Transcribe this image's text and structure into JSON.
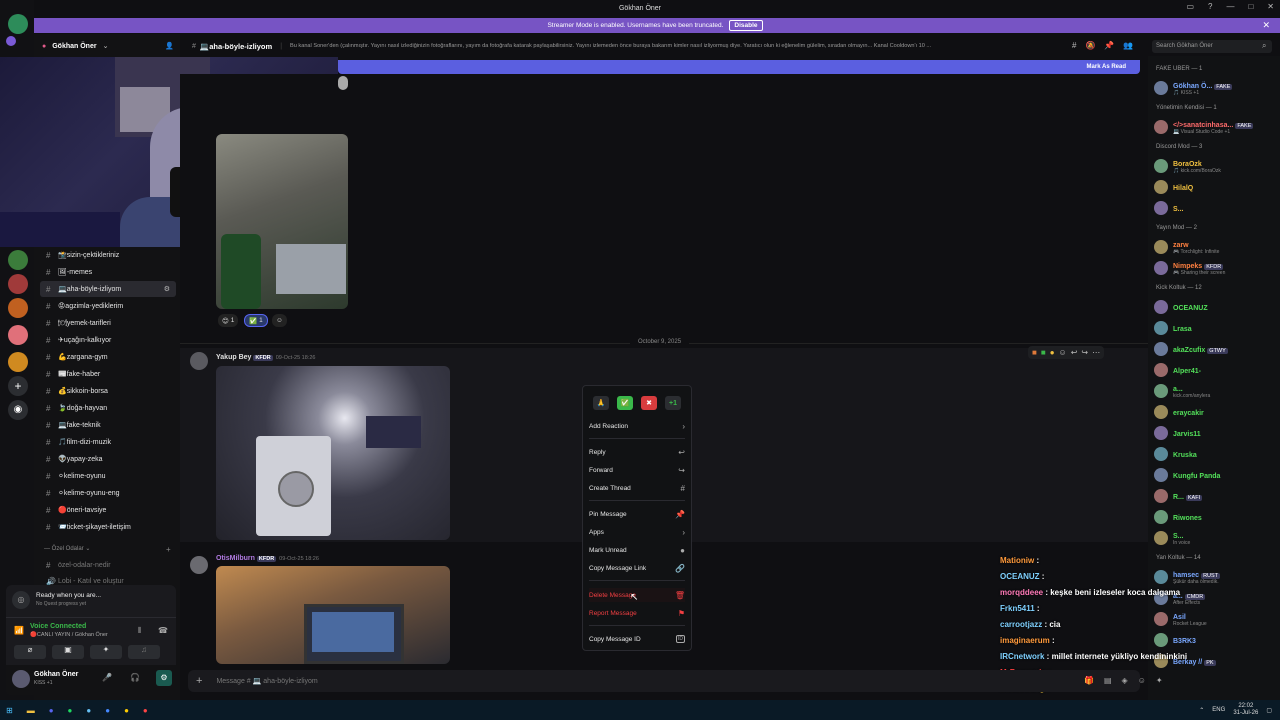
{
  "window": {
    "title": "Gökhan Öner"
  },
  "streamer_bar": {
    "message": "Streamer Mode is enabled. Usernames have been truncated.",
    "button": "Disable"
  },
  "server": {
    "name": "Gökhan Öner"
  },
  "channels": [
    {
      "label": "📸sizin-çektikleriniz",
      "active": false
    },
    {
      "label": "🖼-memes",
      "active": false
    },
    {
      "label": "💻aha-böyle-izliyom",
      "active": true
    },
    {
      "label": "😡agzimla-yediklerim",
      "active": false
    },
    {
      "label": "🍽yemek-tarifleri",
      "active": false
    },
    {
      "label": "✈uçağın-kalkıyor",
      "active": false
    },
    {
      "label": "💪zargana-gym",
      "active": false
    },
    {
      "label": "📰fake-haber",
      "active": false
    },
    {
      "label": "💰sikkoin-borsa",
      "active": false
    },
    {
      "label": "🍃doğa-hayvan",
      "active": false
    },
    {
      "label": "💻fake-teknik",
      "active": false
    },
    {
      "label": "🎵film-dizi-muzik",
      "active": false
    },
    {
      "label": "👽yapay-zeka",
      "active": false
    },
    {
      "label": "⚪kelime-oyunu",
      "active": false
    },
    {
      "label": "⚪kelime-oyunu-eng",
      "active": false
    },
    {
      "label": "🔴öneri-tavsiye",
      "active": false
    },
    {
      "label": "📨ticket-şikayet-iletişim",
      "active": false
    }
  ],
  "category_private": "Özel Odalar",
  "private_channels": [
    "özel-odalar-nedir",
    "Lobi - Katıl ve oluştur"
  ],
  "channel_header": {
    "name": "💻aha-böyle-izliyom",
    "topic": "Bu kanal Soner'den (çalınmıştır. Yayını nasıl izlediğinizin fotoğraflarını, yayım da fotoğrafa katarak paylaşabilirsiniz. Yayını izlemeden önce buraya bakarım kimler nasıl izliyormuş diye. Yaratıcı olun ki eğlenelim gülelim, sıradan olmayın... Kanal Cooldown'ı 10 ..."
  },
  "search": {
    "placeholder": "Search Gökhan Öner"
  },
  "new_messages": {
    "mark_label": "Mark As Read"
  },
  "reactions_top": [
    {
      "emoji": "😊",
      "count": "1"
    },
    {
      "emoji": "✅",
      "count": "1"
    }
  ],
  "date_divider": "October 9, 2025",
  "messages": [
    {
      "author": "Yakup Bey",
      "tag": "KFDR",
      "time": "09-Oct-25 18:26"
    },
    {
      "author": "OtisMilburn",
      "tag": "KFDR",
      "time": "09-Oct-25 18:26"
    }
  ],
  "context_menu": {
    "items": [
      {
        "label": "Add Reaction",
        "icon": "›"
      },
      {
        "label": "Reply",
        "icon": "↩"
      },
      {
        "label": "Forward",
        "icon": "↪"
      },
      {
        "label": "Create Thread",
        "icon": "#"
      },
      {
        "label": "Pin Message",
        "icon": "📌"
      },
      {
        "label": "Apps",
        "icon": "›"
      },
      {
        "label": "Mark Unread",
        "icon": "●"
      },
      {
        "label": "Copy Message Link",
        "icon": "🔗"
      },
      {
        "label": "Delete Message",
        "icon": "🗑"
      },
      {
        "label": "Report Message",
        "icon": "⚑"
      },
      {
        "label": "Copy Message ID",
        "icon": "ID"
      }
    ],
    "quick_reactions": [
      "🙏",
      "✅",
      "✖",
      "+1"
    ]
  },
  "members": {
    "groups": [
      {
        "title": "FAKE UBER — 1",
        "members": [
          {
            "name": "Gökhan Ö...",
            "sub": "🎵 KISS +1",
            "tag": "FAKE",
            "color": "#7aa8ff"
          }
        ]
      },
      {
        "title": "Yönetimin Kendisi — 1",
        "members": [
          {
            "name": "</>sanatcinhasa...",
            "sub": "💻 Visual Studio Code +1",
            "tag": "FAKE",
            "color": "#ff6b6b"
          }
        ]
      },
      {
        "title": "Discord Mod — 3",
        "members": [
          {
            "name": "BoraOzk",
            "sub": "🎵 kick.com/BoraOzk",
            "tag": "",
            "color": "#f0c040"
          },
          {
            "name": "HilalQ",
            "sub": "",
            "tag": "",
            "color": "#f0c040"
          },
          {
            "name": "S...",
            "sub": "",
            "tag": "",
            "color": "#f0c040"
          }
        ]
      },
      {
        "title": "Yayın Mod — 2",
        "members": [
          {
            "name": "zarw",
            "sub": "🎮 Torchlight: Infinite",
            "tag": "",
            "color": "#ff8040"
          },
          {
            "name": "Nimpeks",
            "sub": "🎮 Sharing their screen",
            "tag": "KFDR",
            "color": "#ff8040"
          }
        ]
      },
      {
        "title": "Kick Koltuk — 12",
        "members": [
          {
            "name": "OCEANUZ",
            "sub": "",
            "tag": "",
            "color": "#53e05a"
          },
          {
            "name": "Lrasa",
            "sub": "",
            "tag": "",
            "color": "#53e05a"
          },
          {
            "name": "akaZcufix",
            "sub": "",
            "tag": "GTWY",
            "color": "#53e05a"
          },
          {
            "name": "Alper41-",
            "sub": "",
            "tag": "",
            "color": "#53e05a"
          },
          {
            "name": "a...",
            "sub": "kick.com/anylera",
            "tag": "",
            "color": "#53e05a"
          },
          {
            "name": "eraycakir",
            "sub": "",
            "tag": "",
            "color": "#53e05a"
          },
          {
            "name": "Jarvis11",
            "sub": "",
            "tag": "",
            "color": "#53e05a"
          },
          {
            "name": "Kruska",
            "sub": "",
            "tag": "",
            "color": "#53e05a"
          },
          {
            "name": "Kungfu Panda",
            "sub": "",
            "tag": "",
            "color": "#53e05a"
          },
          {
            "name": "R...",
            "sub": "",
            "tag": "KAFI",
            "color": "#53e05a"
          },
          {
            "name": "Riwones",
            "sub": "",
            "tag": "",
            "color": "#53e05a"
          },
          {
            "name": "S...",
            "sub": "In voice",
            "tag": "",
            "color": "#53e05a"
          }
        ]
      },
      {
        "title": "Yan Koltuk — 14",
        "members": [
          {
            "name": "hamsec",
            "sub": "Şükür daha ölmedik.",
            "tag": "RUST",
            "color": "#7aa8ff"
          },
          {
            "name": "a...",
            "sub": "After Effects",
            "tag": "CMDR",
            "color": "#7aa8ff"
          },
          {
            "name": "Asil",
            "sub": "Rocket League",
            "tag": "",
            "color": "#7aa8ff"
          },
          {
            "name": "B3RK3",
            "sub": "",
            "tag": "",
            "color": "#7aa8ff"
          },
          {
            "name": "Berkay //",
            "sub": "",
            "tag": "PK",
            "color": "#7aa8ff"
          }
        ]
      }
    ]
  },
  "overlay_chat": [
    {
      "user": "Mationiw",
      "text": "",
      "color": "#ff9a3c"
    },
    {
      "user": "OCEANUZ",
      "text": "",
      "color": "#7fd1ff"
    },
    {
      "user": "morqddeee",
      "text": "keşke beni izleseler koca dalgama",
      "color": "#ff7ab8"
    },
    {
      "user": "Frkn5411",
      "text": "",
      "color": "#7fd1ff"
    },
    {
      "user": "carrootjazz",
      "text": "cia",
      "color": "#7fd1ff"
    },
    {
      "user": "imaginaerum",
      "text": "",
      "color": "#ff9a3c"
    },
    {
      "user": "IRCnetwork",
      "text": "millet internete yükliyo kendininkini",
      "color": "#7fd1ff"
    },
    {
      "user": "MrBonsovic",
      "text": "",
      "color": "#ff4040"
    },
    {
      "user": "DestanBing",
      "text": "",
      "color": "#ffd040"
    }
  ],
  "composer": {
    "placeholder": "Message # 💻 aha-böyle-izliyom"
  },
  "user_panel": {
    "quest_title": "Ready when you are...",
    "quest_sub": "No Quest progress yet",
    "voice_status": "Voice Connected",
    "voice_channel": "🔴CANLI YAYIN / Gökhan Öner",
    "user_name": "Gökhan Öner",
    "user_status": "KISS +1"
  },
  "taskbar": {
    "lang": "ENG",
    "time": "22:02",
    "date": "31-Jul-26"
  }
}
